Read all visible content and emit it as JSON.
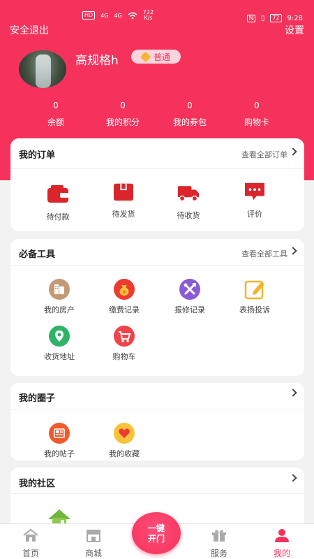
{
  "status_bar": {
    "network_chip": "HD",
    "signal1": "4G",
    "signal2": "4G",
    "speed_value": "722",
    "speed_unit": "K/s",
    "battery": "72",
    "time": "9:28"
  },
  "header": {
    "logout_label": "安全退出",
    "settings_label": "设置",
    "username": "高规格h",
    "level": "普通"
  },
  "stats": [
    {
      "value": "0",
      "label": "余额"
    },
    {
      "value": "0",
      "label": "我的积分"
    },
    {
      "value": "0",
      "label": "我的券包"
    },
    {
      "value": "0",
      "label": "购物卡"
    }
  ],
  "orders": {
    "title": "我的订单",
    "more": "查看全部订单",
    "items": [
      {
        "label": "待付款",
        "icon": "wallet-icon"
      },
      {
        "label": "待发货",
        "icon": "box-icon"
      },
      {
        "label": "待收货",
        "icon": "truck-icon"
      },
      {
        "label": "评价",
        "icon": "comment-icon"
      }
    ]
  },
  "tools": {
    "title": "必备工具",
    "more": "查看全部工具",
    "items": [
      {
        "label": "我的房产",
        "icon": "building-icon"
      },
      {
        "label": "缴费记录",
        "icon": "money-bag-icon"
      },
      {
        "label": "报修记录",
        "icon": "tools-icon"
      },
      {
        "label": "表扬投诉",
        "icon": "edit-icon"
      },
      {
        "label": "收货地址",
        "icon": "location-icon"
      },
      {
        "label": "购物车",
        "icon": "cart-icon"
      }
    ]
  },
  "circle": {
    "title": "我的圈子",
    "items": [
      {
        "label": "我的帖子",
        "icon": "newspaper-icon"
      },
      {
        "label": "我的收藏",
        "icon": "heart-icon"
      }
    ]
  },
  "community": {
    "title": "我的社区"
  },
  "nav": {
    "items": [
      {
        "label": "首页",
        "icon": "home-icon"
      },
      {
        "label": "商城",
        "icon": "store-icon"
      },
      {
        "label": "服务",
        "icon": "gift-icon"
      },
      {
        "label": "我的",
        "icon": "user-icon"
      }
    ],
    "open_line1": "一键",
    "open_line2": "开门"
  },
  "colors": {
    "brand": "#f5325c",
    "order_icons": "#d9252b"
  }
}
